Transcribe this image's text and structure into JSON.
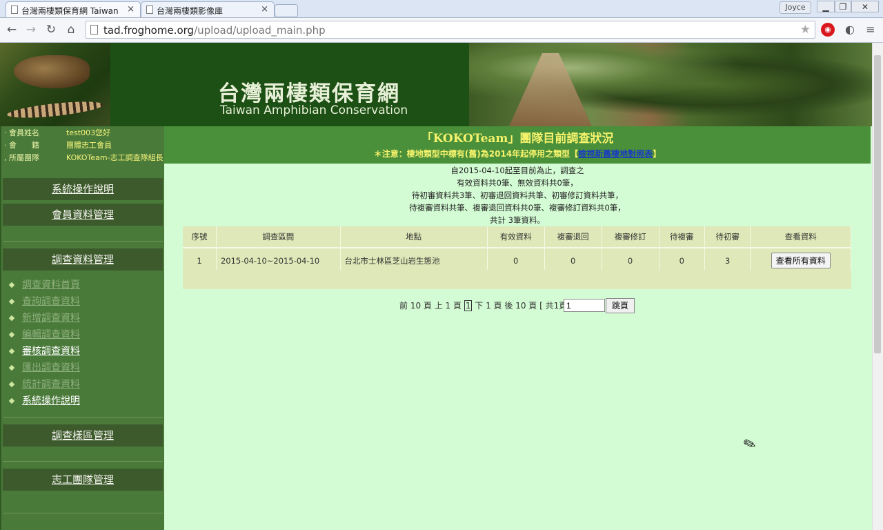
{
  "browser": {
    "tabs": [
      {
        "title": "台灣兩棲類保育網 Taiwan"
      },
      {
        "title": "台灣兩棲類影像庫"
      }
    ],
    "user": "Joyce",
    "url_host": "tad.froghome.org",
    "url_path": "/upload/upload_main.php"
  },
  "banner": {
    "title_zh": "台灣兩棲類保育網",
    "title_en": "Taiwan Amphibian Conservation"
  },
  "member": {
    "name_label": "會員姓名",
    "name_value": "test003您好",
    "status_label": "會　　籍",
    "status_value": "團體志工會員",
    "team_label": "所屬團隊",
    "team_value": "KOKOTeam-志工調查隊組長"
  },
  "sidebar": {
    "sections": [
      "系統操作說明",
      "會員資料管理",
      "調查資料管理",
      "調查樣區管理",
      "志工團隊管理"
    ],
    "items": [
      "調查資料首頁",
      "查詢調查資料",
      "新增調查資料",
      "編輯調查資料",
      "審核調查資料",
      "匯出調查資料",
      "統計調查資料",
      "系統操作說明"
    ]
  },
  "main": {
    "title": "「KOKOTeam」團隊目前調查狀況",
    "note": "＊注意：棲地類型中標有(舊)為2014年起停用之類型【",
    "note_link": "檢視新舊棲地對照表",
    "note_end": "】",
    "summary": [
      "自2015-04-10起至目前為止，調查之",
      "有效資料共0筆、無效資料共0筆，",
      "待初審資料共3筆、初審退回資料共筆、初審修訂資料共筆，",
      "待複審資料共筆、複審退回資料共0筆、複審修訂資料共0筆，",
      "共計 3筆資料。"
    ]
  },
  "table": {
    "headers": [
      "序號",
      "調查區間",
      "地點",
      "有效資料",
      "複審退回",
      "複審修訂",
      "待複審",
      "待初審",
      "查看資料"
    ],
    "rows": [
      {
        "no": "1",
        "period": "2015-04-10~2015-04-10",
        "place": "台北市士林區芝山岩生態池",
        "valid": "0",
        "rev_return": "0",
        "rev_edit": "0",
        "wait_rev": "0",
        "wait_init": "3",
        "button": "查看所有資料"
      }
    ]
  },
  "pager": {
    "prev10": "前 10 頁",
    "prev1": "上 1 頁",
    "current": "1",
    "next1": "下 1 頁",
    "next10": "後 10 頁",
    "total": "[ 共1頁 ]",
    "input_value": "1",
    "jump": "跳頁"
  }
}
